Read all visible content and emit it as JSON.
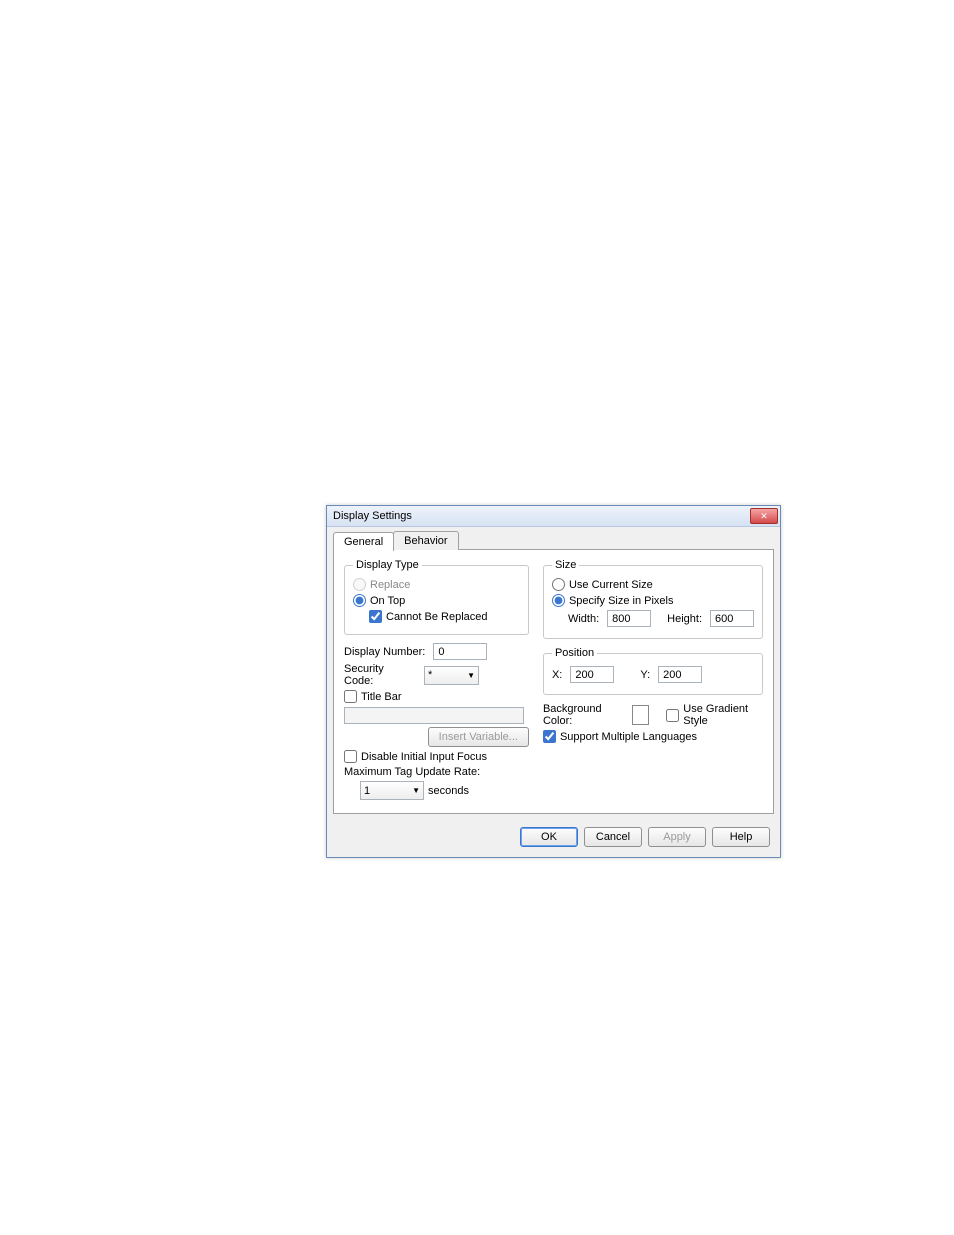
{
  "dialog": {
    "title": "Display Settings",
    "tabs": {
      "general": "General",
      "behavior": "Behavior"
    },
    "displayType": {
      "legend": "Display Type",
      "replace": "Replace",
      "onTop": "On Top",
      "cannotBeReplaced": "Cannot Be Replaced"
    },
    "displayNumber": {
      "label": "Display Number:",
      "value": "0"
    },
    "securityCode": {
      "label": "Security Code:",
      "selected": "*"
    },
    "titleBar": {
      "label": "Title Bar",
      "value": ""
    },
    "insertVariable": "Insert Variable...",
    "disableInitialInputFocus": "Disable Initial Input Focus",
    "maxTagRate": {
      "label": "Maximum Tag Update Rate:",
      "value": "1",
      "unit": "seconds"
    },
    "size": {
      "legend": "Size",
      "useCurrent": "Use Current Size",
      "specify": "Specify Size in Pixels",
      "widthLabel": "Width:",
      "widthValue": "800",
      "heightLabel": "Height:",
      "heightValue": "600"
    },
    "position": {
      "legend": "Position",
      "xLabel": "X:",
      "xValue": "200",
      "yLabel": "Y:",
      "yValue": "200"
    },
    "bgColorLabel": "Background Color:",
    "useGradient": "Use Gradient Style",
    "supportMultiLang": "Support Multiple Languages",
    "buttons": {
      "ok": "OK",
      "cancel": "Cancel",
      "apply": "Apply",
      "help": "Help"
    }
  }
}
